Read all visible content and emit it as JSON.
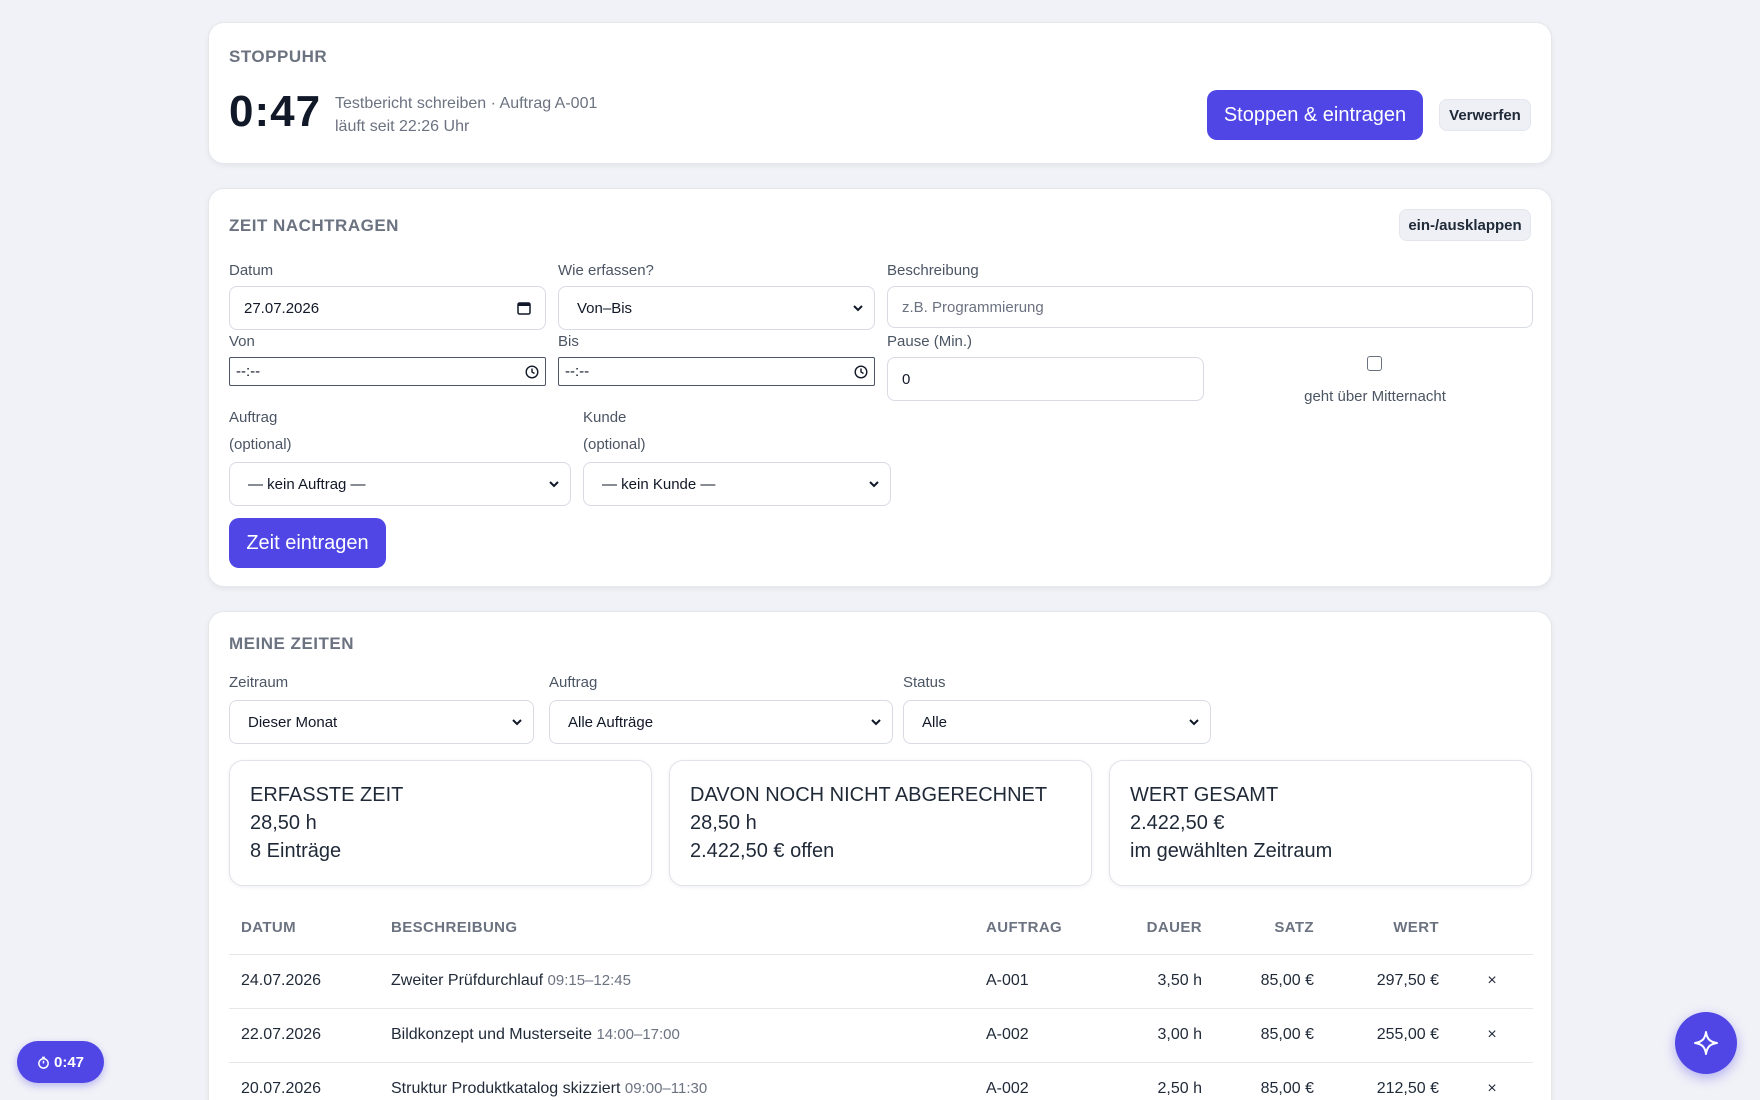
{
  "stopwatch": {
    "title": "Stoppuhr",
    "time": "0:47",
    "task": "Testbericht schreiben · Auftrag A-001",
    "since": "läuft seit 22:26 Uhr",
    "stop_label": "Stoppen & eintragen",
    "discard_label": "Verwerfen"
  },
  "add_time": {
    "title": "Zeit nachtragen",
    "toggle_label": "ein-/ausklappen",
    "date_label": "Datum",
    "date_value": "27.07.2026",
    "mode_label": "Wie erfassen?",
    "mode_value": "Von–Bis",
    "description_label": "Beschreibung",
    "description_placeholder": "z.B. Programmierung",
    "from_label": "Von",
    "from_value": "--:--",
    "to_label": "Bis",
    "to_value": "--:--",
    "pause_label": "Pause (Min.)",
    "pause_value": "0",
    "midnight_label": "geht über Mitternacht",
    "midnight_checked": false,
    "order_label": "Auftrag",
    "order_optional": "(optional)",
    "order_value": "— kein Auftrag —",
    "customer_label": "Kunde",
    "customer_optional": "(optional)",
    "customer_value": "— kein Kunde —",
    "submit_label": "Zeit eintragen"
  },
  "my_times": {
    "title": "Meine Zeiten",
    "filters": {
      "period_label": "Zeitraum",
      "period_value": "Dieser Monat",
      "order_label": "Auftrag",
      "order_value": "Alle Aufträge",
      "status_label": "Status",
      "status_value": "Alle"
    },
    "stats": [
      {
        "title": "Erfasste Zeit",
        "value": "28,50 h",
        "sub": "8 Einträge"
      },
      {
        "title": "Davon noch nicht abgerechnet",
        "value": "28,50 h",
        "sub": "2.422,50 € offen"
      },
      {
        "title": "Wert gesamt",
        "value": "2.422,50 €",
        "sub": "im gewählten Zeitraum"
      }
    ],
    "table": {
      "headers": {
        "date": "DATUM",
        "description": "BESCHREIBUNG",
        "order": "AUFTRAG",
        "duration": "DAUER",
        "rate": "SATZ",
        "value": "WERT"
      },
      "rows": [
        {
          "date": "24.07.2026",
          "description": "Zweiter Prüfdurchlauf",
          "time": "09:15–12:45",
          "order": "A-001",
          "duration": "3,50 h",
          "rate": "85,00 €",
          "value": "297,50 €",
          "delete": "×"
        },
        {
          "date": "22.07.2026",
          "description": "Bildkonzept und Musterseite",
          "time": "14:00–17:00",
          "order": "A-002",
          "duration": "3,00 h",
          "rate": "85,00 €",
          "value": "255,00 €",
          "delete": "×"
        },
        {
          "date": "20.07.2026",
          "description": "Struktur Produktkatalog skizziert",
          "time": "09:00–11:30",
          "order": "A-002",
          "duration": "2,50 h",
          "rate": "85,00 €",
          "value": "212,50 €",
          "delete": "×"
        }
      ]
    }
  },
  "floating": {
    "timer_pill": "0:47",
    "assistant_icon": "sparkle-icon",
    "accent": "#4f46e5"
  }
}
